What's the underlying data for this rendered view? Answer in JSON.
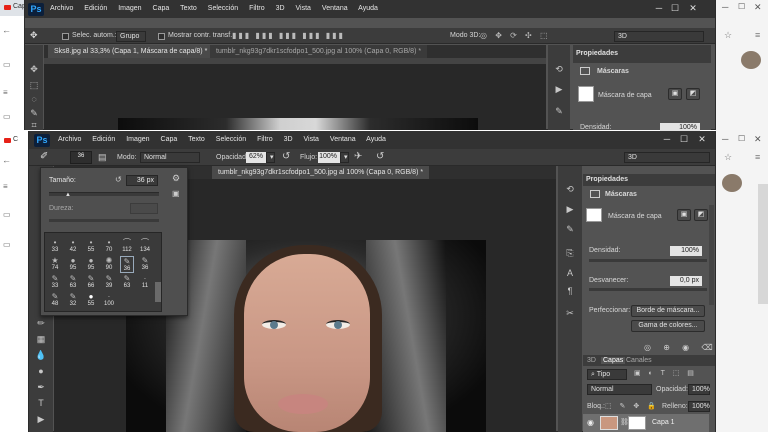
{
  "browser": {
    "tab_text_back": "Cap",
    "tab_text_front": "C"
  },
  "back_window": {
    "app_logo": "Ps",
    "menu": [
      "Archivo",
      "Edición",
      "Imagen",
      "Capa",
      "Texto",
      "Selección",
      "Filtro",
      "3D",
      "Vista",
      "Ventana",
      "Ayuda"
    ],
    "options": {
      "auto_select_label": "Selec. autom.:",
      "auto_select_value": "Grupo",
      "transform_label": "Mostrar contr. transf.",
      "mode3d_label": "Modo 3D:",
      "workspace": "3D"
    },
    "tabs": [
      {
        "label": "Sks8.jpg al 33,3% (Capa 1, Máscara de capa/8) *",
        "active": true
      },
      {
        "label": "tumblr_nkg93g7dkr1scfodpo1_500.jpg al 100% (Capa 0, RGB/8) *",
        "active": false
      }
    ],
    "panel": {
      "tab": "Propiedades",
      "section": "Máscaras",
      "mask_label": "Máscara de capa",
      "density_label": "Densidad:",
      "density_value": "100%"
    }
  },
  "front_window": {
    "app_logo": "Ps",
    "menu": [
      "Archivo",
      "Edición",
      "Imagen",
      "Capa",
      "Texto",
      "Selección",
      "Filtro",
      "3D",
      "Vista",
      "Ventana",
      "Ayuda"
    ],
    "options": {
      "brush_size": "36",
      "mode_label": "Modo:",
      "mode_value": "Normal",
      "opacity_label": "Opacidad:",
      "opacity_value": "62%",
      "flow_label": "Flujo:",
      "flow_value": "100%",
      "workspace": "3D"
    },
    "tabs": [
      {
        "label": "tumblr_nkg93g7dkr1scfodpo1_500.jpg al 100% (Capa 0, RGB/8) *",
        "active": true
      }
    ],
    "brush_picker": {
      "size_label": "Tamaño:",
      "size_value": "36 px",
      "hardness_label": "Dureza:",
      "presets": [
        "33",
        "42",
        "55",
        "70",
        "112",
        "134",
        "74",
        "95",
        "95",
        "90",
        "36",
        "36",
        "33",
        "63",
        "66",
        "39",
        "63",
        "11",
        "48",
        "32",
        "55",
        "100"
      ]
    },
    "properties": {
      "tab": "Propiedades",
      "section": "Máscaras",
      "mask_label": "Máscara de capa",
      "density_label": "Densidad:",
      "density_value": "100%",
      "feather_label": "Desvanecer:",
      "feather_value": "0,0 px",
      "refine_label": "Perfeccionar:",
      "mask_edge_button": "Borde de máscara...",
      "color_range_button": "Gama de colores..."
    },
    "layers": {
      "tabs": [
        "3D",
        "Capas",
        "Canales"
      ],
      "filter_label": "Tipo",
      "blend_mode": "Normal",
      "opacity_label": "Opacidad:",
      "opacity_value": "100%",
      "lock_label": "Bloq.:",
      "fill_label": "Relleno:",
      "fill_value": "100%",
      "layer_name": "Capa 1"
    }
  }
}
